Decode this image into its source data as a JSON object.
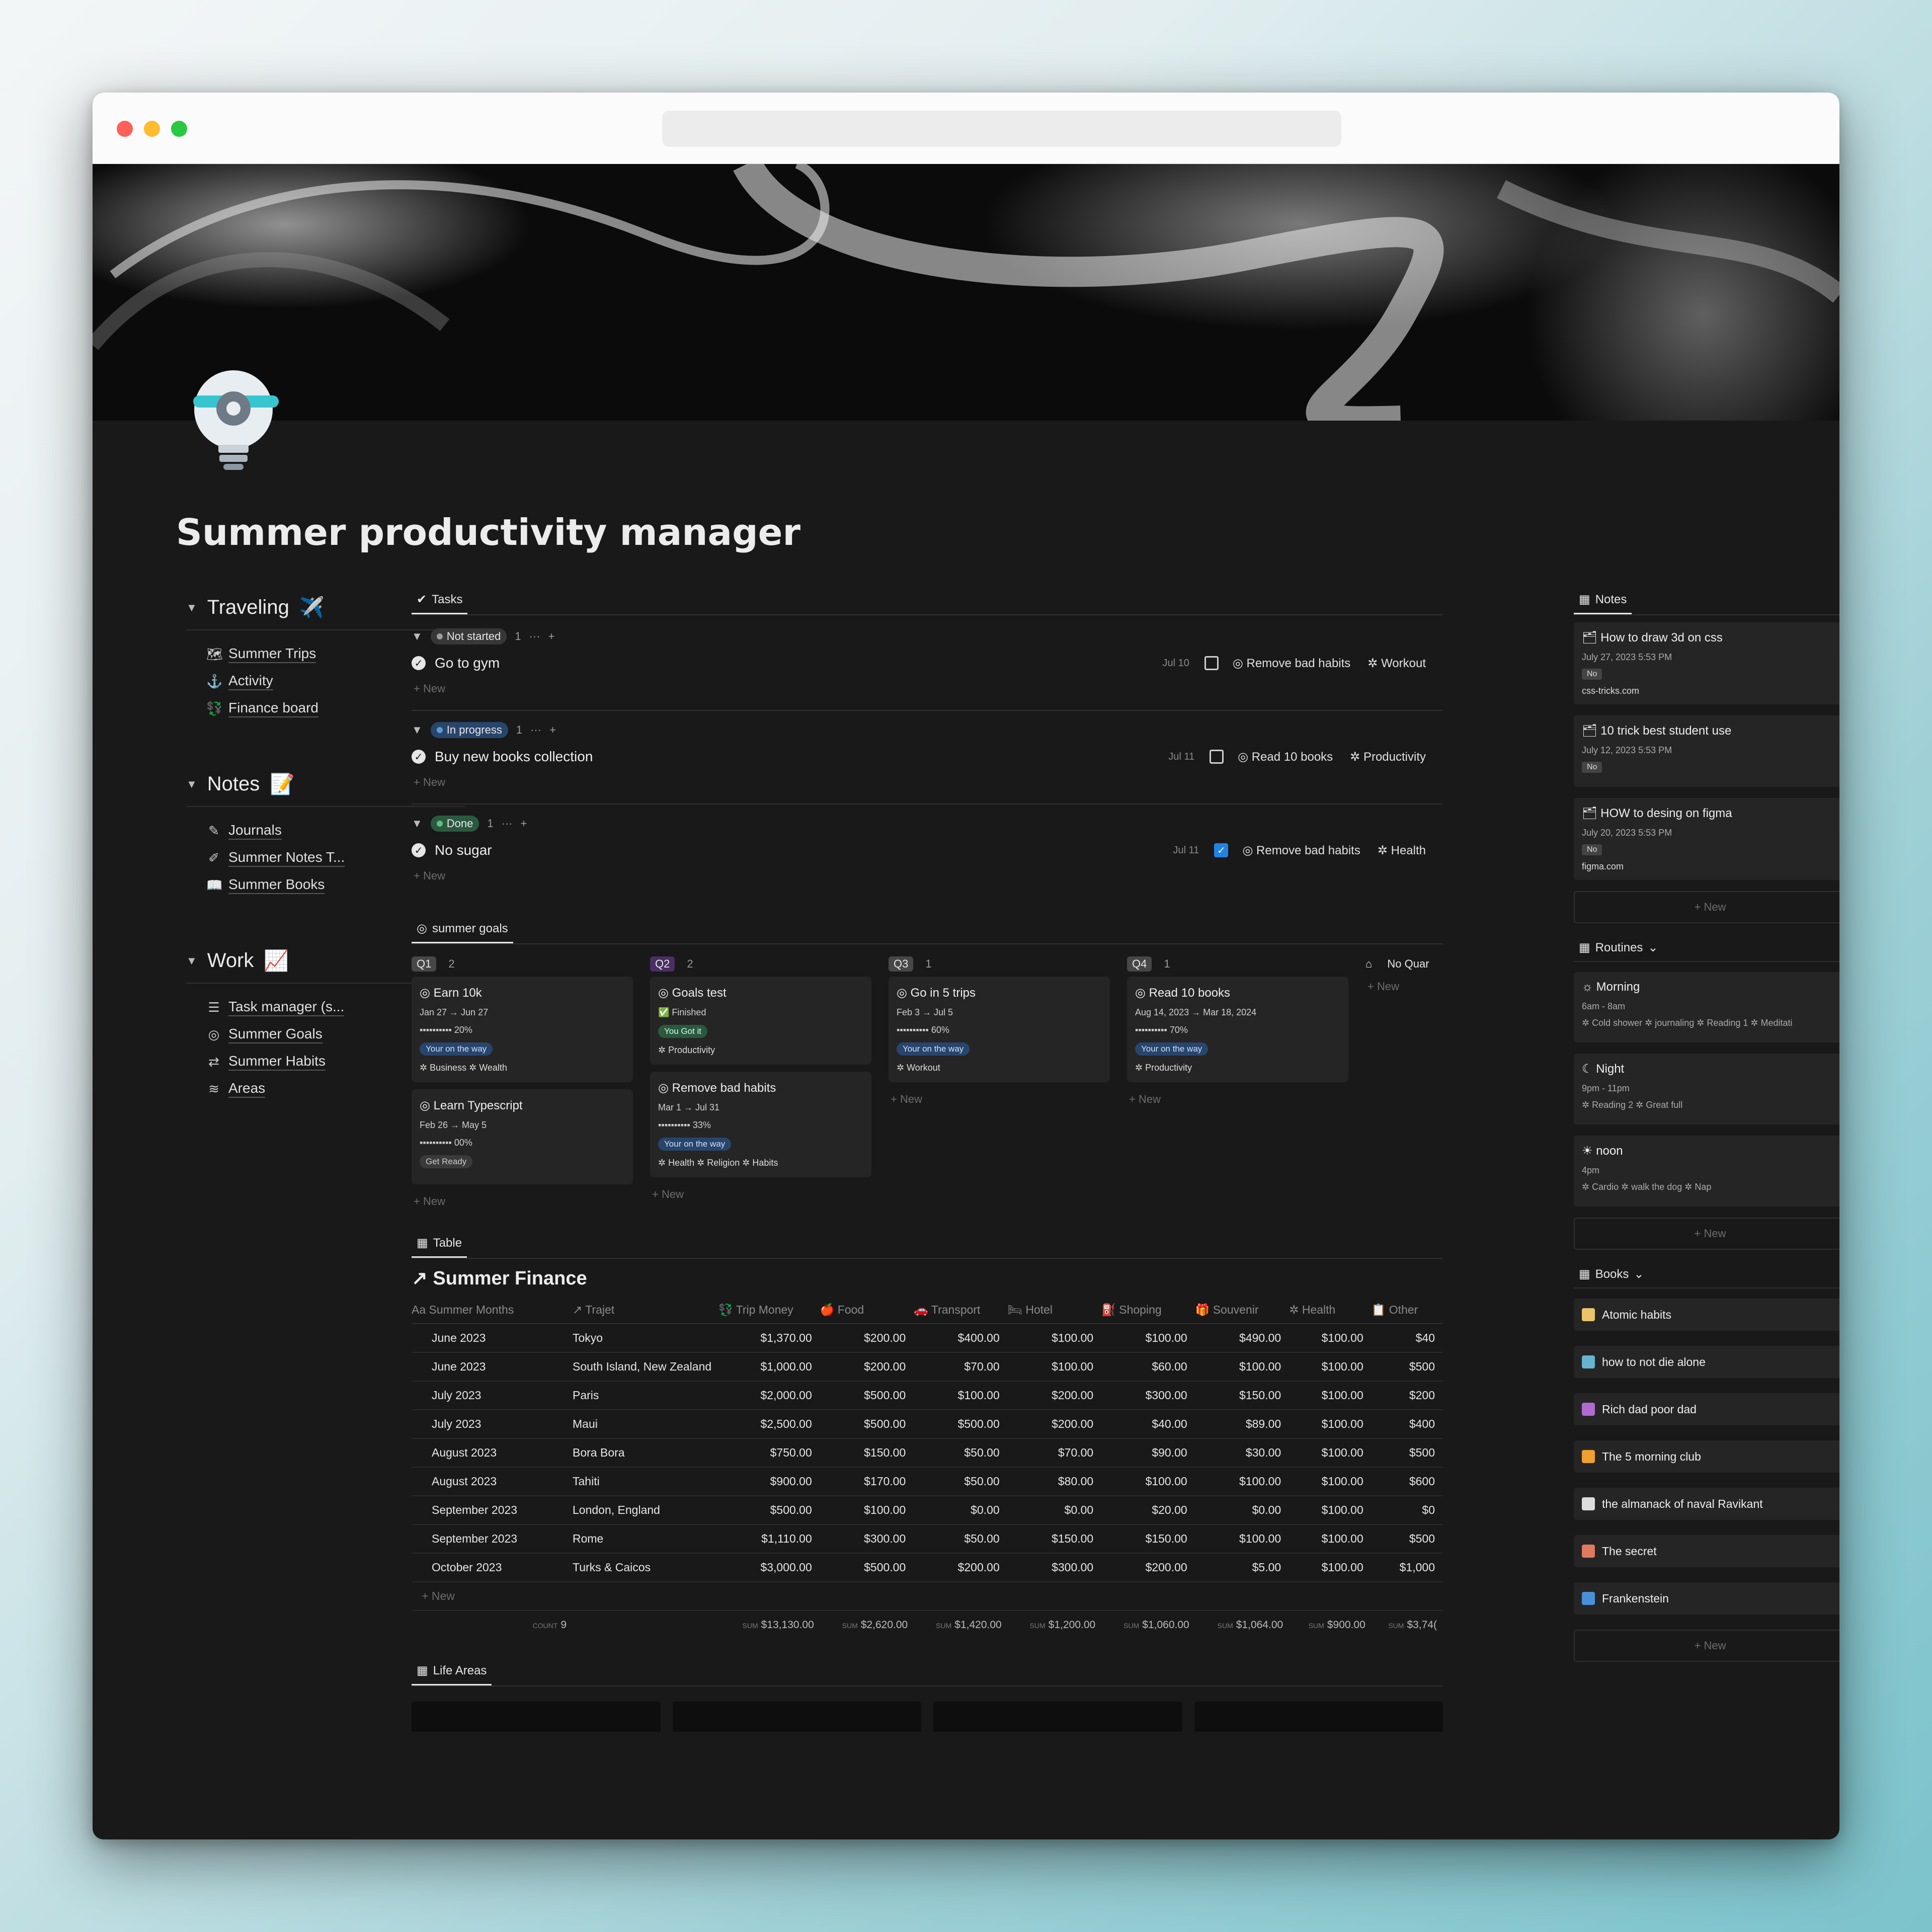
{
  "page": {
    "title": "Summer productivity manager"
  },
  "sidebar": [
    {
      "heading": "Traveling",
      "emoji": "✈️",
      "items": [
        {
          "icon": "map-icon",
          "glyph": "🗺",
          "label": "Summer Trips"
        },
        {
          "icon": "anchor-icon",
          "glyph": "⚓",
          "label": "Activity"
        },
        {
          "icon": "money-icon",
          "glyph": "💱",
          "label": "Finance board"
        }
      ]
    },
    {
      "heading": "Notes",
      "emoji": "📝",
      "items": [
        {
          "icon": "journal-icon",
          "glyph": "✎",
          "label": "Journals"
        },
        {
          "icon": "edit-icon",
          "glyph": "✐",
          "label": "Summer Notes T..."
        },
        {
          "icon": "book-icon",
          "glyph": "📖",
          "label": "Summer Books"
        }
      ]
    },
    {
      "heading": "Work",
      "emoji": "📈",
      "items": [
        {
          "icon": "checklist-icon",
          "glyph": "☰",
          "label": "Task manager (s..."
        },
        {
          "icon": "target-icon",
          "glyph": "◎",
          "label": "Summer Goals"
        },
        {
          "icon": "repeat-icon",
          "glyph": "⇄",
          "label": "Summer Habits"
        },
        {
          "icon": "layers-icon",
          "glyph": "≋",
          "label": "Areas"
        }
      ]
    }
  ],
  "tasks": {
    "tab": "Tasks",
    "new_label": "New",
    "groups": [
      {
        "status": "Not started",
        "color": "gray",
        "count": "1",
        "items": [
          {
            "name": "Go to gym",
            "date": "Jul 10",
            "done": false,
            "goal": "Remove bad habits",
            "area": "Workout"
          }
        ]
      },
      {
        "status": "In progress",
        "color": "blue",
        "count": "1",
        "items": [
          {
            "name": "Buy new books collection",
            "date": "Jul 11",
            "done": false,
            "goal": "Read 10 books",
            "area": "Productivity"
          }
        ]
      },
      {
        "status": "Done",
        "color": "green",
        "count": "1",
        "items": [
          {
            "name": "No sugar",
            "date": "Jul 11",
            "done": true,
            "goal": "Remove bad habits",
            "area": "Health"
          }
        ]
      }
    ]
  },
  "goals": {
    "tab": "summer goals",
    "new_label": "New",
    "columns": [
      {
        "quarter": "Q1",
        "count": "2",
        "cards": [
          {
            "title": "Earn 10k",
            "dates": "Jan 27 → Jun 27",
            "progress": "20%",
            "status": "Your on the way",
            "status_color": "blue",
            "tags": "Business  ✲ Wealth"
          },
          {
            "title": "Learn Typescript",
            "dates": "Feb 26 → May 5",
            "progress": "00%",
            "status": "Get Ready",
            "status_color": "gray",
            "tags": ""
          }
        ]
      },
      {
        "quarter": "Q2",
        "count": "2",
        "cards": [
          {
            "title": "Goals test",
            "dates": "✅ Finished",
            "progress": "",
            "status": "You Got it",
            "status_color": "green",
            "tags": "Productivity"
          },
          {
            "title": "Remove bad habits",
            "dates": "Mar 1 → Jul 31",
            "progress": "33%",
            "status": "Your on the way",
            "status_color": "blue",
            "tags": "Health  ✲ Religion  ✲ Habits"
          }
        ]
      },
      {
        "quarter": "Q3",
        "count": "1",
        "cards": [
          {
            "title": "Go in 5 trips",
            "dates": "Feb 3 → Jul 5",
            "progress": "60%",
            "status": "Your on the way",
            "status_color": "blue",
            "tags": "Workout"
          }
        ]
      },
      {
        "quarter": "Q4",
        "count": "1",
        "cards": [
          {
            "title": "Read 10 books",
            "dates": "Aug 14, 2023 → Mar 18, 2024",
            "progress": "70%",
            "status": "Your on the way",
            "status_color": "blue",
            "tags": "Productivity"
          }
        ]
      }
    ],
    "no_quarter": "No Quar"
  },
  "finance": {
    "tab": "Table",
    "title": "Summer Finance",
    "columns": [
      "Summer Months",
      "Trajet",
      "Trip Money",
      "Food",
      "Transport",
      "Hotel",
      "Shoping",
      "Souvenir",
      "Health",
      "Other"
    ],
    "rows": [
      [
        "June 2023",
        "Tokyo",
        "$1,370.00",
        "$200.00",
        "$400.00",
        "$100.00",
        "$100.00",
        "$490.00",
        "$100.00",
        "$40"
      ],
      [
        "June 2023",
        "South Island, New Zealand",
        "$1,000.00",
        "$200.00",
        "$70.00",
        "$100.00",
        "$60.00",
        "$100.00",
        "$100.00",
        "$500"
      ],
      [
        "July 2023",
        "Paris",
        "$2,000.00",
        "$500.00",
        "$100.00",
        "$200.00",
        "$300.00",
        "$150.00",
        "$100.00",
        "$200"
      ],
      [
        "July 2023",
        "Maui",
        "$2,500.00",
        "$500.00",
        "$500.00",
        "$200.00",
        "$40.00",
        "$89.00",
        "$100.00",
        "$400"
      ],
      [
        "August 2023",
        "Bora Bora",
        "$750.00",
        "$150.00",
        "$50.00",
        "$70.00",
        "$90.00",
        "$30.00",
        "$100.00",
        "$500"
      ],
      [
        "August 2023",
        "Tahiti",
        "$900.00",
        "$170.00",
        "$50.00",
        "$80.00",
        "$100.00",
        "$100.00",
        "$100.00",
        "$600"
      ],
      [
        "September 2023",
        "London, England",
        "$500.00",
        "$100.00",
        "$0.00",
        "$0.00",
        "$20.00",
        "$0.00",
        "$100.00",
        "$0"
      ],
      [
        "September 2023",
        "Rome",
        "$1,110.00",
        "$300.00",
        "$50.00",
        "$150.00",
        "$150.00",
        "$100.00",
        "$100.00",
        "$500"
      ],
      [
        "October 2023",
        "Turks & Caicos",
        "$3,000.00",
        "$500.00",
        "$200.00",
        "$300.00",
        "$200.00",
        "$5.00",
        "$100.00",
        "$1,000"
      ]
    ],
    "new_label": "New",
    "count_label": "COUNT",
    "count": "9",
    "sum_label": "SUM",
    "sums": [
      "$13,130.00",
      "$2,620.00",
      "$1,420.00",
      "$1,200.00",
      "$1,060.00",
      "$1,064.00",
      "$900.00",
      "$3,74("
    ]
  },
  "life_areas": {
    "tab": "Life Areas"
  },
  "notes": {
    "tab": "Notes",
    "items": [
      {
        "title": "How to draw 3d on css",
        "date": "July 27, 2023 5:53 PM",
        "flag": "No",
        "url": "css-tricks.com"
      },
      {
        "title": "10 trick best student use",
        "date": "July 12, 2023 5:53 PM",
        "flag": "No",
        "url": ""
      },
      {
        "title": "HOW to desing on figma",
        "date": "July 20, 2023 5:53 PM",
        "flag": "No",
        "url": "figma.com"
      }
    ],
    "new_label": "New"
  },
  "routines": {
    "tab": "Routines",
    "items": [
      {
        "title": "Morning",
        "time": "6am - 8am",
        "tags": "✲ Cold shower  ✲ journaling  ✲ Reading 1  ✲ Meditati"
      },
      {
        "title": "Night",
        "time": "9pm - 11pm",
        "tags": "✲ Reading 2  ✲ Great full"
      },
      {
        "title": "noon",
        "time": "4pm",
        "tags": "✲ Cardio  ✲ walk the dog  ✲ Nap"
      }
    ],
    "new_label": "New"
  },
  "books": {
    "tab": "Books",
    "items": [
      {
        "title": "Atomic habits",
        "color": "#e9c46a"
      },
      {
        "title": "how to not die alone",
        "color": "#64b5cd"
      },
      {
        "title": "Rich dad poor dad",
        "color": "#b06ad0"
      },
      {
        "title": "The 5 morning club",
        "color": "#f0a030"
      },
      {
        "title": "the almanack of naval Ravikant",
        "color": "#dddddd"
      },
      {
        "title": "The secret",
        "color": "#e07a5f"
      },
      {
        "title": "Frankenstein",
        "color": "#4a90d9"
      }
    ],
    "new_label": "New"
  }
}
